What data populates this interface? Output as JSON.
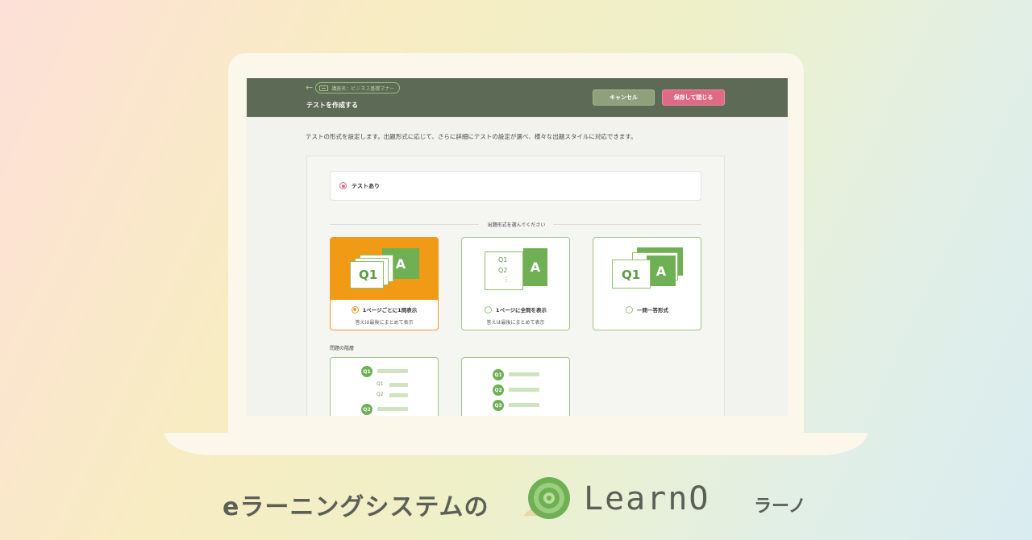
{
  "header": {
    "back_label": "講座名：ビジネス基礎マナー",
    "title": "テストを作成する",
    "cancel_label": "キャンセル",
    "save_label": "保存して閉じる"
  },
  "description": "テストの形式を設定します。出題形式に応じて、さらに詳細にテストの設定が選べ、様々な出題スタイルに対応できます。",
  "test_toggle": {
    "label": "テストあり",
    "selected": true
  },
  "format_section": {
    "heading": "出題形式を選んでください",
    "options": [
      {
        "label": "1ページごとに1問表示",
        "sub": "答えは最後にまとめて表示",
        "selected": true,
        "art_q": "Q1",
        "art_a": "A"
      },
      {
        "label": "1ページに全問を表示",
        "sub": "答えは最後にまとめて表示",
        "selected": false,
        "art_q1": "Q1",
        "art_q2": "Q2",
        "art_dots": "⋮",
        "art_a": "A"
      },
      {
        "label": "一問一答形式",
        "sub": "",
        "selected": false,
        "art_q": "Q1",
        "art_a": "A"
      }
    ]
  },
  "hierarchy_section": {
    "heading": "問題の階層",
    "cards": [
      {
        "q1": "Q1",
        "sub1": "Q1",
        "sub2": "Q2",
        "q2": "Q2"
      },
      {
        "q1": "Q1",
        "q2": "Q2",
        "q3": "Q3"
      }
    ]
  },
  "brand": {
    "tagline": "eラーニングシステムの",
    "name": "LearnO",
    "kana": "ラーノ",
    "colors": {
      "green": "#6fb054",
      "dark": "#5a5f57"
    }
  },
  "colors": {
    "header_bg": "#5d6a55",
    "cancel_bg": "#8fa07d",
    "save_bg": "#e06a86",
    "selected_orange": "#f09a15",
    "accent_green": "#6fb054"
  }
}
